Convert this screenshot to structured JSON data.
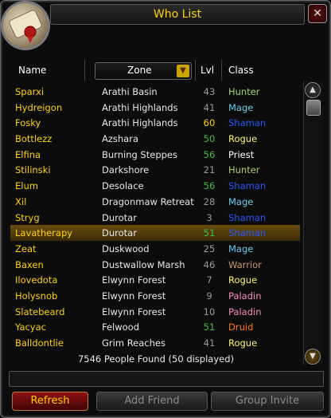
{
  "window": {
    "title": "Who List"
  },
  "columns": {
    "name": "Name",
    "zone": "Zone",
    "level": "Lvl",
    "class": "Class"
  },
  "rows": [
    {
      "name": "Sparxi",
      "zone": "Arathi Basin",
      "level": "43",
      "level_color": "#9a9a9a",
      "class": "Hunter",
      "class_color": "#a9d271"
    },
    {
      "name": "Hydreigon",
      "zone": "Arathi Highlands",
      "level": "41",
      "level_color": "#9a9a9a",
      "class": "Mage",
      "class_color": "#69ccf0"
    },
    {
      "name": "Fosky",
      "zone": "Arathi Highlands",
      "level": "60",
      "level_color": "#ffd200",
      "class": "Shaman",
      "class_color": "#2459ff"
    },
    {
      "name": "Bottlezz",
      "zone": "Azshara",
      "level": "50",
      "level_color": "#40c040",
      "class": "Rogue",
      "class_color": "#fff569"
    },
    {
      "name": "Elfina",
      "zone": "Burning Steppes",
      "level": "56",
      "level_color": "#40c040",
      "class": "Priest",
      "class_color": "#ffffff"
    },
    {
      "name": "Stilinski",
      "zone": "Darkshore",
      "level": "21",
      "level_color": "#9a9a9a",
      "class": "Hunter",
      "class_color": "#a9d271"
    },
    {
      "name": "Elum",
      "zone": "Desolace",
      "level": "56",
      "level_color": "#40c040",
      "class": "Shaman",
      "class_color": "#2459ff"
    },
    {
      "name": "Xil",
      "zone": "Dragonmaw Retreat",
      "level": "28",
      "level_color": "#9a9a9a",
      "class": "Mage",
      "class_color": "#69ccf0"
    },
    {
      "name": "Stryg",
      "zone": "Durotar",
      "level": "3",
      "level_color": "#9a9a9a",
      "class": "Shaman",
      "class_color": "#2459ff"
    },
    {
      "name": "Lavatherapy",
      "zone": "Durotar",
      "level": "51",
      "level_color": "#40c040",
      "class": "Shaman",
      "class_color": "#2459ff"
    },
    {
      "name": "Zeat",
      "zone": "Duskwood",
      "level": "25",
      "level_color": "#9a9a9a",
      "class": "Mage",
      "class_color": "#69ccf0"
    },
    {
      "name": "Baxen",
      "zone": "Dustwallow Marsh",
      "level": "46",
      "level_color": "#9a9a9a",
      "class": "Warrior",
      "class_color": "#c79c6e"
    },
    {
      "name": "Ilovedota",
      "zone": "Elwynn Forest",
      "level": "7",
      "level_color": "#9a9a9a",
      "class": "Rogue",
      "class_color": "#fff569"
    },
    {
      "name": "Holysnob",
      "zone": "Elwynn Forest",
      "level": "9",
      "level_color": "#9a9a9a",
      "class": "Paladin",
      "class_color": "#f58cba"
    },
    {
      "name": "Slatebeard",
      "zone": "Elwynn Forest",
      "level": "10",
      "level_color": "#9a9a9a",
      "class": "Paladin",
      "class_color": "#f58cba"
    },
    {
      "name": "Yacyac",
      "zone": "Felwood",
      "level": "51",
      "level_color": "#40c040",
      "class": "Druid",
      "class_color": "#ff7d0a"
    },
    {
      "name": "Balldontlie",
      "zone": "Grim Reaches",
      "level": "41",
      "level_color": "#9a9a9a",
      "class": "Rogue",
      "class_color": "#fff569"
    }
  ],
  "selected_row": "Lavatherapy",
  "footer": {
    "found_text": "7546 People Found  (50 displayed)"
  },
  "buttons": {
    "refresh": "Refresh",
    "add_friend": "Add Friend",
    "group_invite": "Group Invite"
  },
  "icons": {
    "close": "close-icon",
    "portrait": "scroll-portrait-icon",
    "dropdown": "chevron-down-icon",
    "scroll_up": "chevron-up-icon",
    "scroll_down": "chevron-down-icon"
  },
  "colors": {
    "title": "#ffd200",
    "name": "#ffd200",
    "selected_bg": "#6a4e10"
  }
}
